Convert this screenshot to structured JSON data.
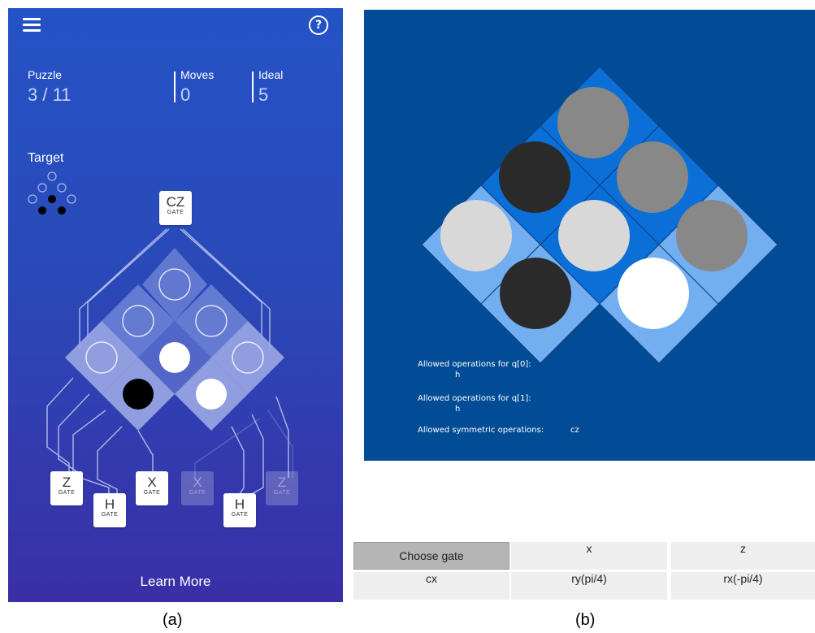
{
  "panel_a": {
    "puzzle": {
      "label": "Puzzle",
      "value": "3 / 11"
    },
    "moves": {
      "label": "Moves",
      "value": "0"
    },
    "ideal": {
      "label": "Ideal",
      "value": "5"
    },
    "target_label": "Target",
    "help_glyph": "?",
    "gates": [
      {
        "name": "CZ",
        "sub": "GATE",
        "enabled": true
      },
      {
        "name": "Z",
        "sub": "GATE",
        "enabled": true
      },
      {
        "name": "H",
        "sub": "GATE",
        "enabled": true
      },
      {
        "name": "X",
        "sub": "GATE",
        "enabled": true
      },
      {
        "name": "X",
        "sub": "GATE",
        "enabled": false
      },
      {
        "name": "H",
        "sub": "GATE",
        "enabled": true
      },
      {
        "name": "Z",
        "sub": "GATE",
        "enabled": false
      }
    ],
    "learn_more": "Learn More",
    "icons": [
      "menu-icon",
      "help-icon"
    ]
  },
  "panel_b": {
    "ops": {
      "q0_label": "Allowed operations for q[0]:",
      "q0_ops": "h",
      "q1_label": "Allowed operations for q[1]:",
      "q1_ops": "h",
      "sym_label": "Allowed symmetric operations:",
      "sym_ops": "cz"
    },
    "gate_buttons": {
      "choose": "Choose gate",
      "x": "x",
      "z": "z",
      "cx": "cx",
      "ry": "ry(pi/4)",
      "rx": "rx(-pi/4)"
    }
  },
  "captions": {
    "a": "(a)",
    "b": "(b)"
  },
  "colors": {
    "panel_a_top": "#2453c6",
    "panel_a_bottom": "#3a2fa6",
    "panel_b_bg": "#024c96",
    "tile_dark": "#0a6fd6",
    "tile_light": "#72aef0",
    "ball_black": "#2a2a2a",
    "ball_gray": "#888888",
    "ball_light": "#d8d8d8",
    "ball_white": "#ffffff"
  }
}
